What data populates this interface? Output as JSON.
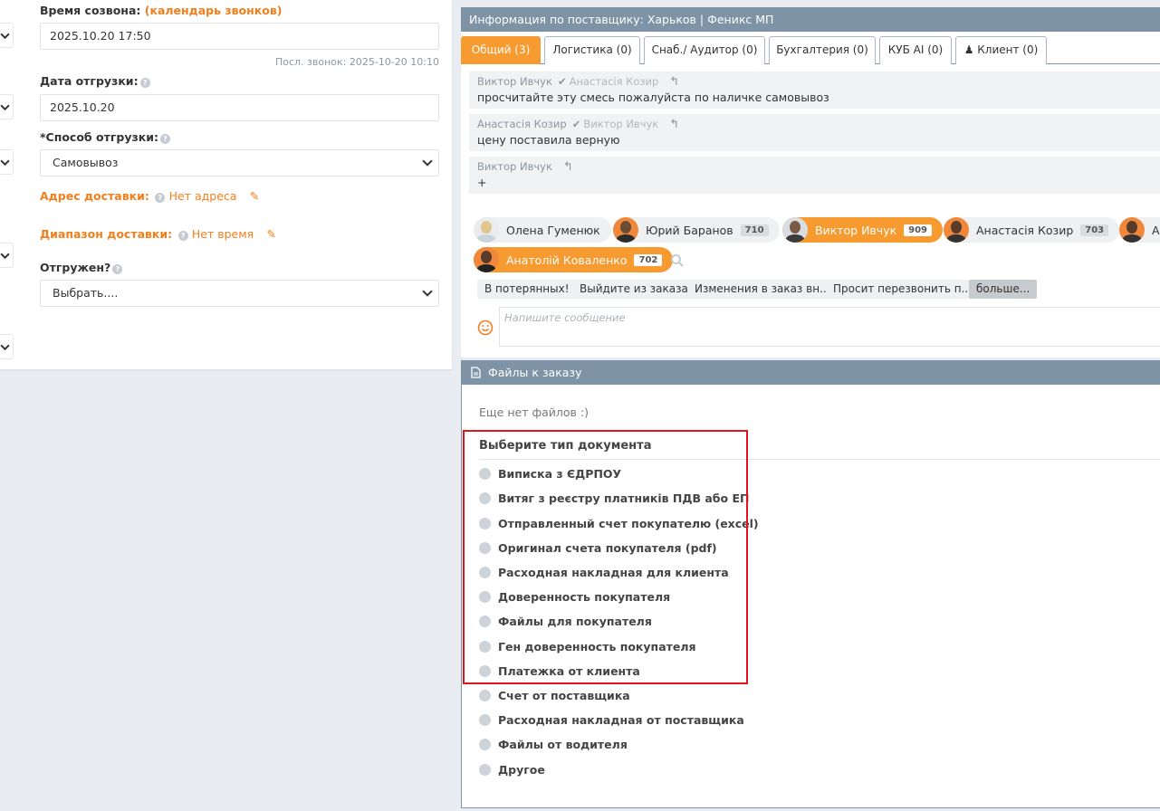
{
  "left": {
    "call_time_label": "Время созвона:",
    "call_calendar_link": "(календарь звонков)",
    "call_time_value": "2025.10.20 17:50",
    "last_call": "Посл. звонок: 2025-10-20 10:10",
    "ship_date_label": "Дата отгрузки:",
    "ship_date_value": "2025.10.20",
    "ship_method_label": "*Способ отгрузки:",
    "ship_method_value": "Самовывоз",
    "address_label": "Адрес доставки:",
    "address_value": "Нет адреса",
    "range_label": "Диапазон доставки:",
    "range_value": "Нет время",
    "shipped_label": "Отгружен?",
    "shipped_value": "Выбрать...."
  },
  "supplier": {
    "header": "Информация по поставщику: Харьков | Феникс МП",
    "tabs": [
      "Общий (3)",
      "Логистика (0)",
      "Снаб./ Аудитор (0)",
      "Бухгалтерия (0)",
      "КУБ AI (0)",
      "Клиент (0)"
    ],
    "messages": [
      {
        "from": "Виктор Ивчук",
        "to": "Анастасія Козир",
        "text": "просчитайте эту смесь пожалуйста по наличке самовывоз"
      },
      {
        "from": "Анастасія Козир",
        "to": "Виктор Ивчук",
        "text": "цену поставила верную"
      },
      {
        "from": "Виктор Ивчук",
        "to": "",
        "text": "+"
      }
    ],
    "users": [
      {
        "name": "Олена Гуменюк",
        "count": ""
      },
      {
        "name": "Юрий Баранов",
        "count": "710"
      },
      {
        "name": "Виктор Ивчук",
        "count": "909"
      },
      {
        "name": "Анастасія Козир",
        "count": "703"
      },
      {
        "name": "Ан",
        "count": ""
      },
      {
        "name": "Анатолій Коваленко",
        "count": "702"
      }
    ],
    "quick_replies": [
      "В потерянных!",
      "Выйдите из заказа",
      "Изменения в заказ вн...",
      "Просит перезвонить п...",
      "больше..."
    ],
    "message_placeholder": "Напишите сообщение"
  },
  "files": {
    "header": "Файлы к заказу",
    "empty": "Еще нет файлов :)",
    "doc_type_title": "Выберите тип документа",
    "doc_types": [
      "Виписка з ЄДРПОУ",
      "Витяг з реєстру платників ПДВ або ЕП",
      "Отправленный счет покупателю (excel)",
      "Оригинал счета покупателя (pdf)",
      "Расходная накладная для клиента",
      "Доверенность покупателя",
      "Файлы для покупателя",
      "Ген доверенность покупателя",
      "Платежка от клиента",
      "Счет от поставщика",
      "Расходная накладная от поставщика",
      "Файлы от водителя",
      "Другое"
    ]
  },
  "colors": {
    "accent": "#f79a2f",
    "header": "#7e93a6",
    "highlight": "#e0141a"
  },
  "icons": [
    "chevron-down-icon",
    "help-icon",
    "pencil-icon",
    "check-icon",
    "reply-icon",
    "search-icon",
    "smile-icon",
    "file-icon",
    "user-icon"
  ]
}
